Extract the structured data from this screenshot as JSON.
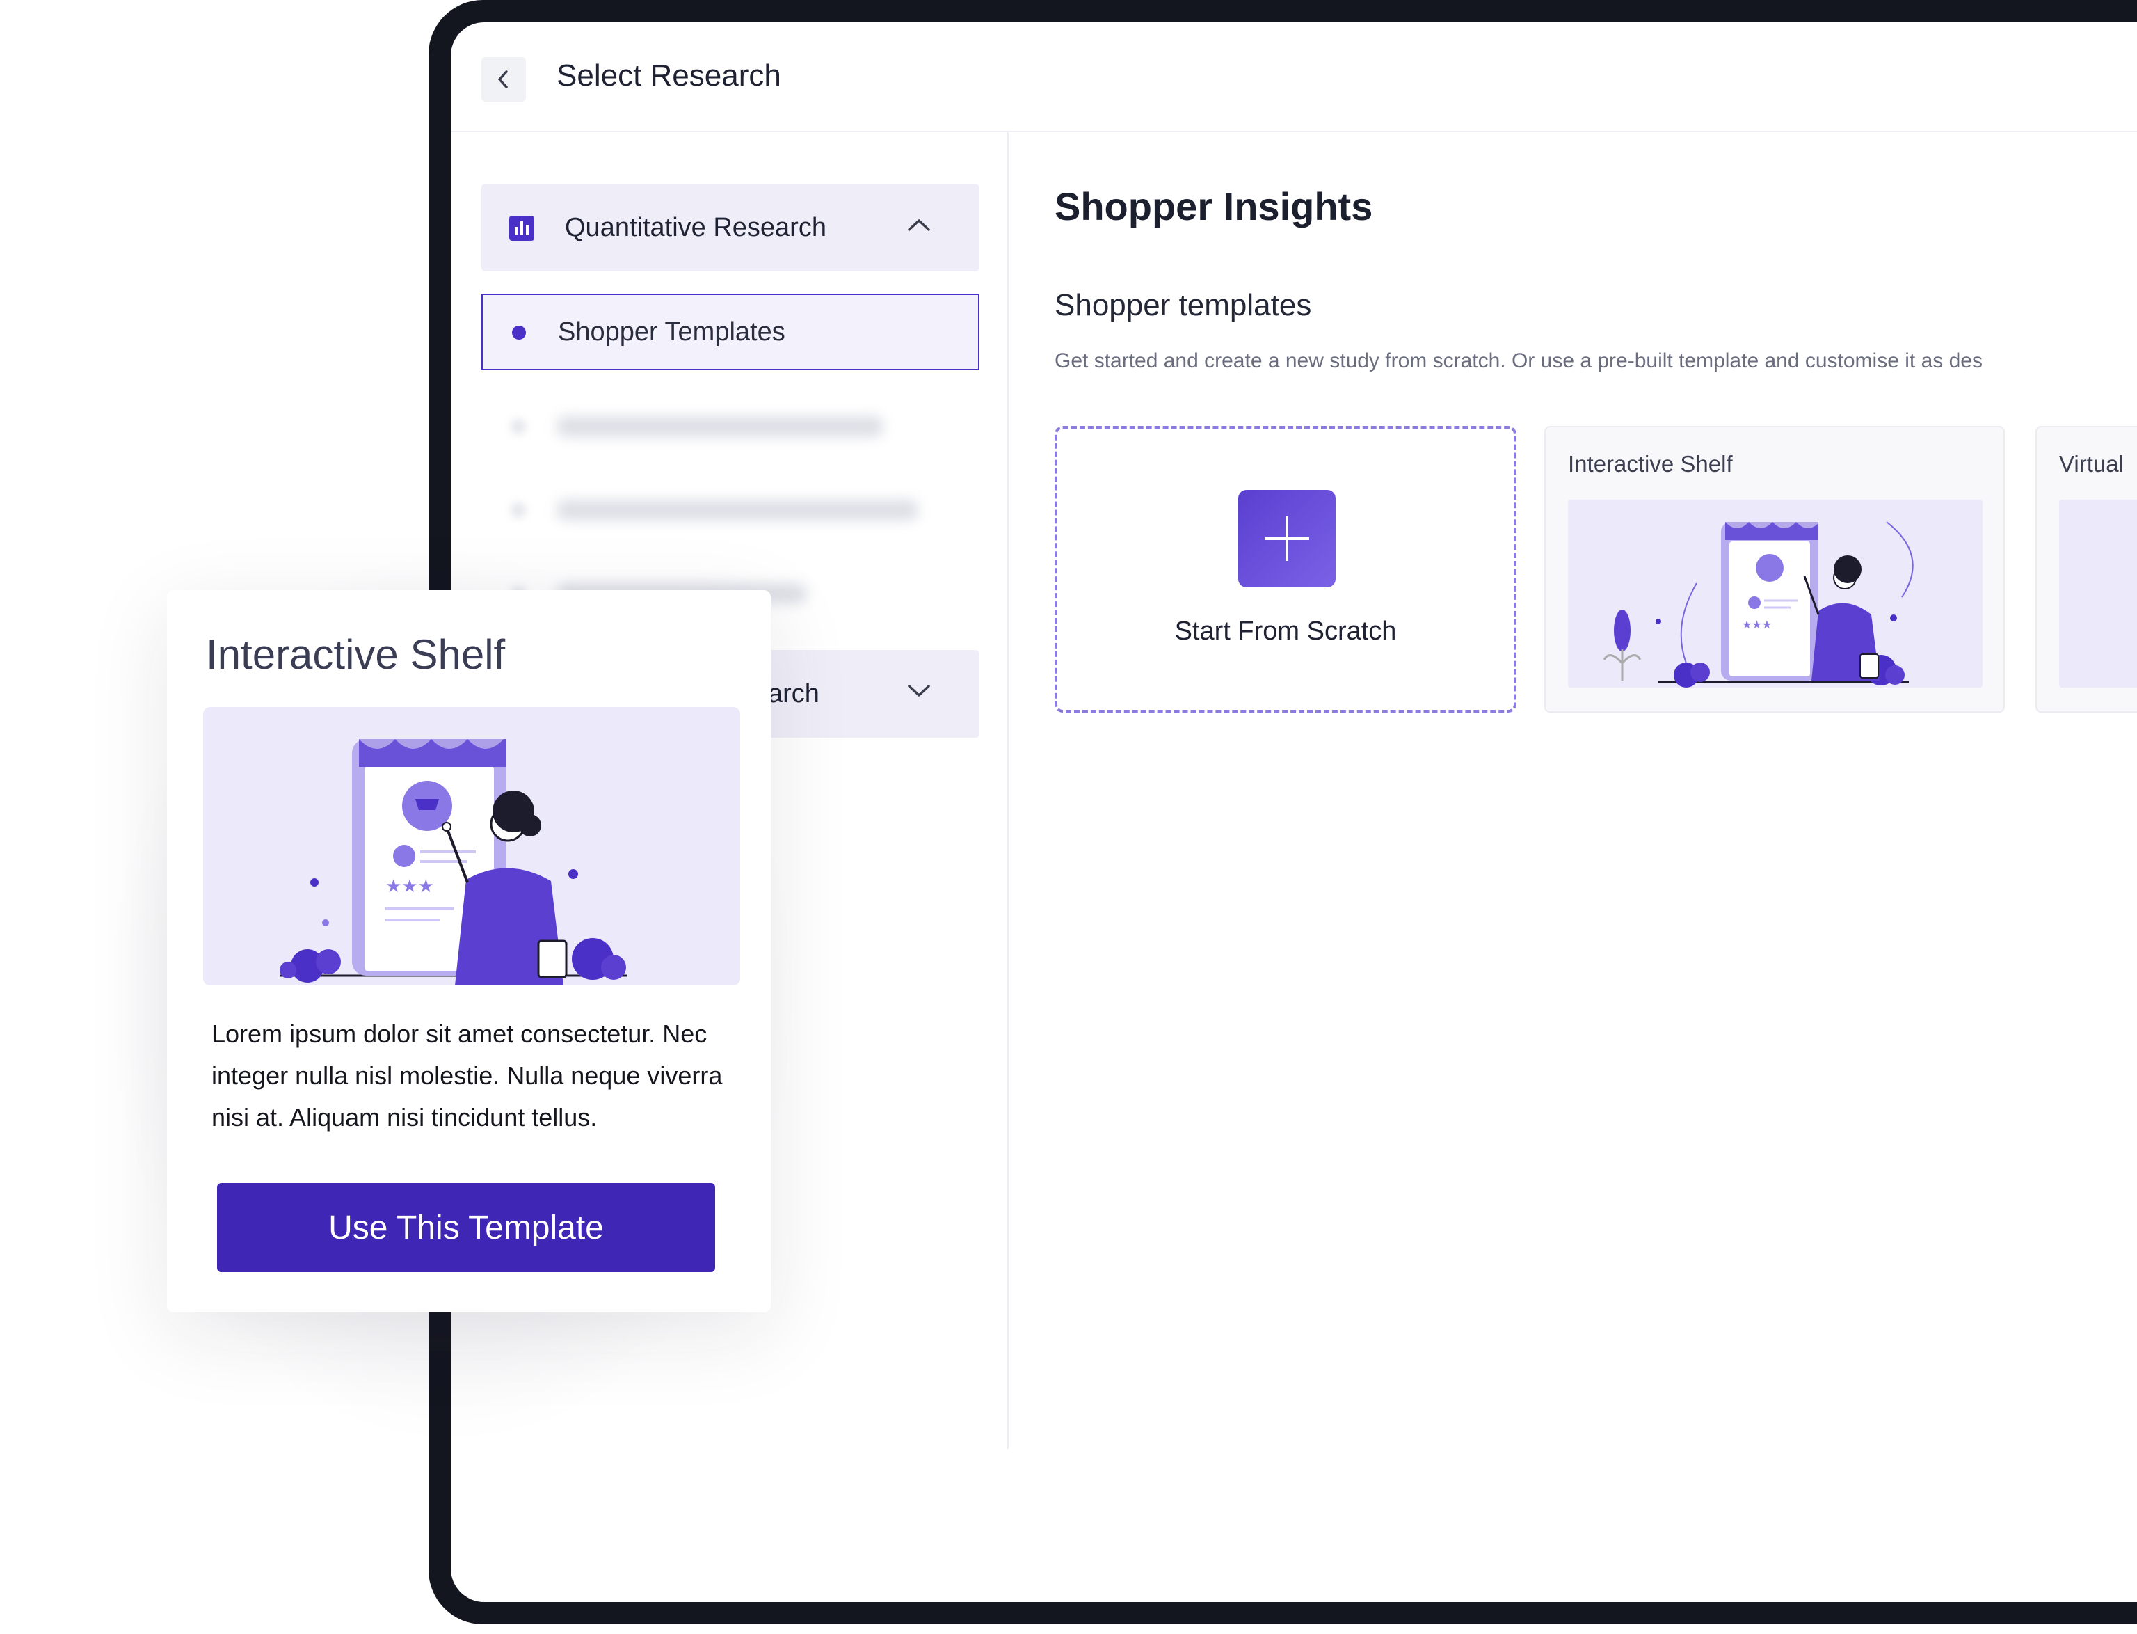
{
  "header": {
    "title": "Select Research",
    "back_icon": "chevron-left-icon"
  },
  "sidebar": {
    "groups": [
      {
        "label": "Quantitative Research",
        "icon": "bar-chart-icon",
        "expanded": true,
        "items": [
          {
            "label": "Shopper Templates",
            "selected": true
          }
        ]
      },
      {
        "label": "arch",
        "expanded": false
      }
    ]
  },
  "main": {
    "title": "Shopper Insights",
    "section_title": "Shopper templates",
    "section_desc": "Get started and create a new study from scratch. Or use a pre-built template and customise it as des",
    "cards": [
      {
        "label": "Start From Scratch",
        "icon": "plus-icon"
      },
      {
        "label": "Interactive Shelf"
      },
      {
        "label": "Virtual"
      }
    ]
  },
  "popup": {
    "title": "Interactive Shelf",
    "description": "Lorem ipsum dolor sit amet consectetur. Nec integer nulla nisl molestie. Nulla neque viverra nisi at. Aliquam nisi tincidunt tellus.",
    "cta_label": "Use This Template"
  },
  "colors": {
    "accent": "#4b30c7",
    "cta": "#3f26b5",
    "frame": "#13151f",
    "illustration_bg": "#ece9fb"
  }
}
